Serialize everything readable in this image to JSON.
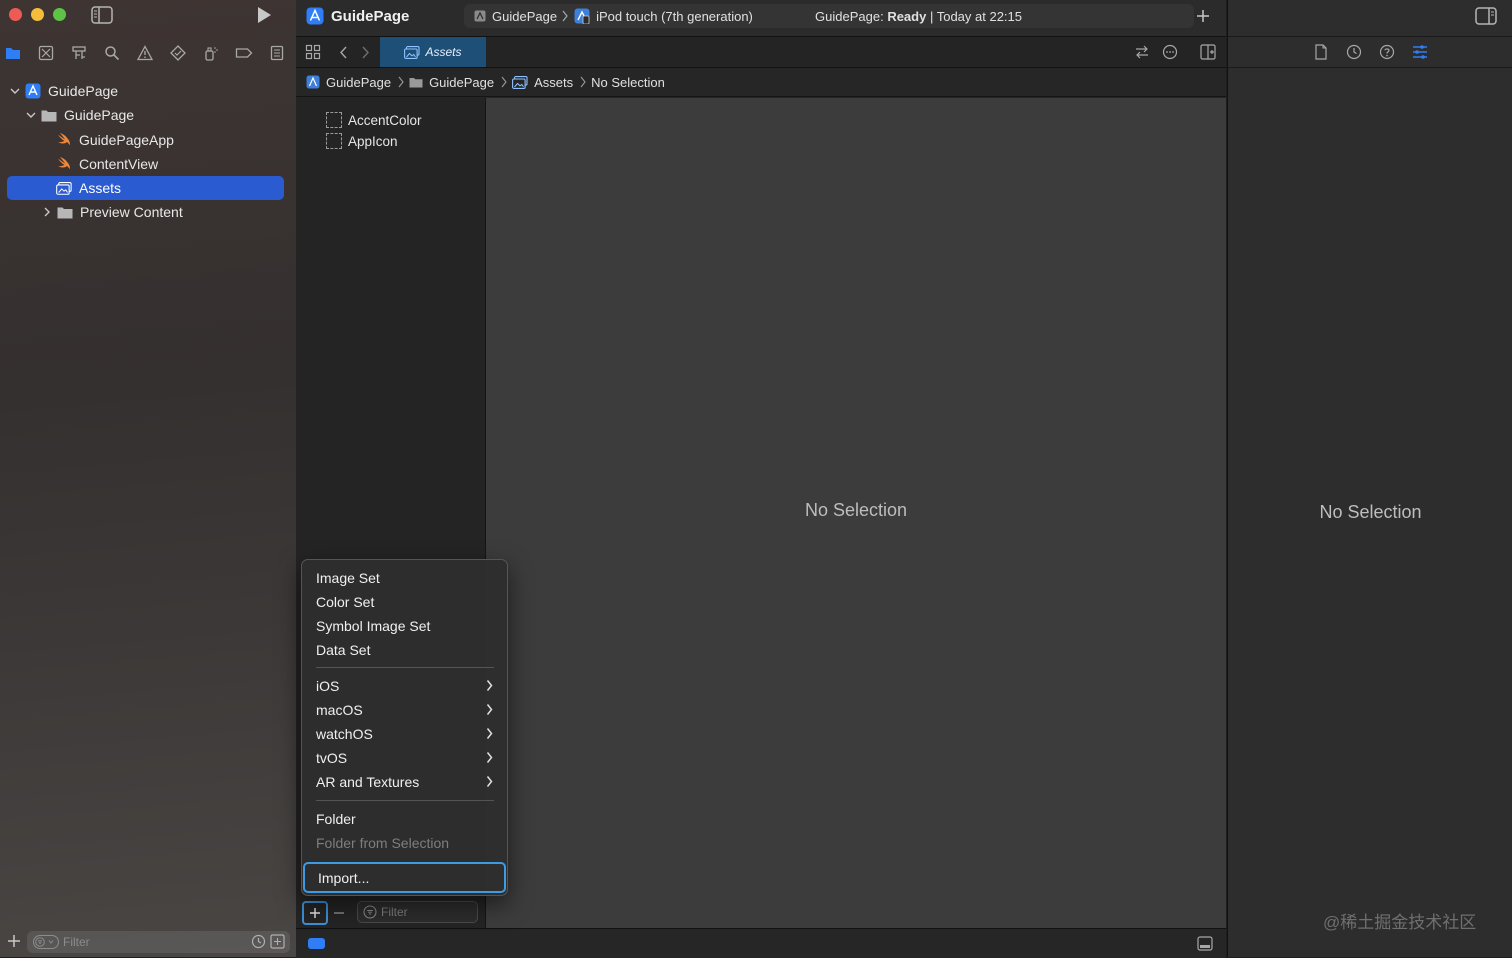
{
  "window": {
    "title": "GuidePage",
    "scheme": "GuidePage",
    "destination": "iPod touch (7th generation)",
    "status_prefix": "GuidePage: ",
    "status_state": "Ready",
    "status_time": " | Today at 22:15"
  },
  "navigator": {
    "tree": [
      {
        "label": "GuidePage",
        "icon": "project-icon"
      },
      {
        "label": "GuidePage",
        "icon": "folder-icon"
      },
      {
        "label": "GuidePageApp",
        "icon": "swift-file-icon"
      },
      {
        "label": "ContentView",
        "icon": "swift-file-icon"
      },
      {
        "label": "Assets",
        "icon": "asset-catalog-icon",
        "selected": true
      },
      {
        "label": "Preview Content",
        "icon": "folder-icon"
      }
    ],
    "filter_placeholder": "Filter"
  },
  "editor": {
    "tab_label": "Assets",
    "breadcrumb": [
      "GuidePage",
      "GuidePage",
      "Assets",
      "No Selection"
    ],
    "assets": [
      "AccentColor",
      "AppIcon"
    ],
    "empty_text": "No Selection",
    "list_filter_placeholder": "Filter"
  },
  "context_menu": {
    "group1": [
      "Image Set",
      "Color Set",
      "Symbol Image Set",
      "Data Set"
    ],
    "group2": [
      "iOS",
      "macOS",
      "watchOS",
      "tvOS",
      "AR and Textures"
    ],
    "group3": [
      {
        "label": "Folder",
        "enabled": true
      },
      {
        "label": "Folder from Selection",
        "enabled": false
      }
    ],
    "import_label": "Import..."
  },
  "inspector": {
    "empty_text": "No Selection"
  },
  "watermark": "@稀土掘金技术社区",
  "colors": {
    "accent": "#2a5bd0",
    "focus_ring": "#3d9be4",
    "tab_active": "#1e4f77",
    "swift_orange": "#f0873a"
  }
}
